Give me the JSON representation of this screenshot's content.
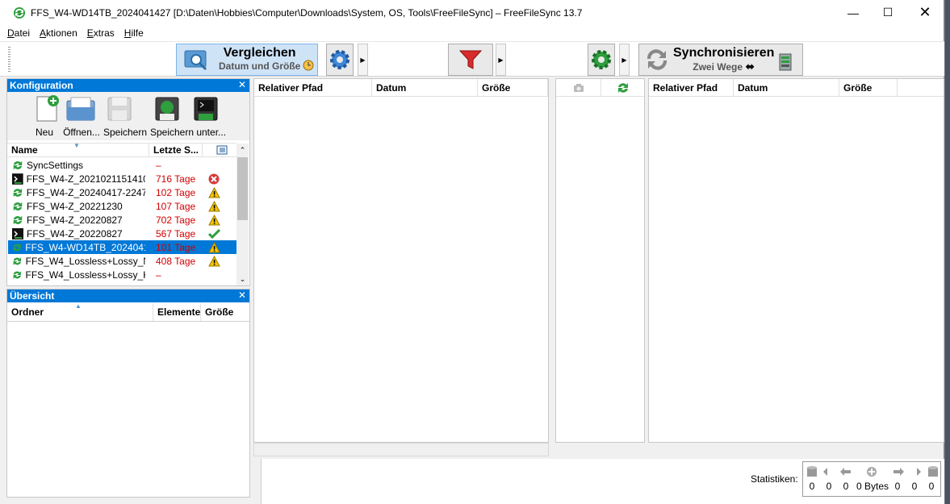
{
  "window": {
    "title": "FFS_W4-WD14TB_2024041427 [D:\\Daten\\Hobbies\\Computer\\Downloads\\System, OS, Tools\\FreeFileSync] – FreeFileSync 13.7"
  },
  "menu": {
    "items": [
      "Datei",
      "Aktionen",
      "Extras",
      "Hilfe"
    ]
  },
  "toolbar": {
    "compare_title": "Vergleichen",
    "compare_sub": "Datum und Größe",
    "sync_title": "Synchronisieren",
    "sync_sub": "Zwei Wege"
  },
  "config_panel": {
    "title": "Konfiguration",
    "buttons": [
      "Neu",
      "Öffnen...",
      "Speichern",
      "Speichern unter..."
    ],
    "columns": {
      "name": "Name",
      "last_sync": "Letzte S..."
    },
    "rows": [
      {
        "name": "SyncSettings",
        "last": "–",
        "status": "",
        "icon": "sync-green-icon"
      },
      {
        "name": "FFS_W4-Z_2021021151410",
        "last": "716 Tage",
        "status": "error-icon",
        "icon": "batch-icon"
      },
      {
        "name": "FFS_W4-Z_20240417-2247",
        "last": "102 Tage",
        "status": "warning-icon",
        "icon": "sync-green-icon"
      },
      {
        "name": "FFS_W4-Z_20221230",
        "last": "107 Tage",
        "status": "warning-icon",
        "icon": "sync-green-icon"
      },
      {
        "name": "FFS_W4-Z_20220827",
        "last": "702 Tage",
        "status": "warning-icon",
        "icon": "sync-green-icon"
      },
      {
        "name": "FFS_W4-Z_20220827",
        "last": "567 Tage",
        "status": "check-icon",
        "icon": "batch-icon"
      },
      {
        "name": "FFS_W4-WD14TB_20240414...",
        "last": "101 Tage",
        "status": "warning-icon",
        "icon": "sync-green-icon",
        "selected": true
      },
      {
        "name": "FFS_W4_Lossless+Lossy_N...",
        "last": "408 Tage",
        "status": "warning-icon",
        "icon": "sync-green-icon"
      },
      {
        "name": "FFS_W4_Lossless+Lossy_Ki...",
        "last": "–",
        "status": "",
        "icon": "sync-green-icon"
      }
    ]
  },
  "overview_panel": {
    "title": "Übersicht",
    "columns": {
      "folder": "Ordner",
      "items": "Elemente",
      "size": "Größe"
    }
  },
  "left_grid": {
    "columns": [
      "Relativer Pfad",
      "Datum",
      "Größe"
    ]
  },
  "right_grid": {
    "columns": [
      "Relativer Pfad",
      "Datum",
      "Größe"
    ]
  },
  "statistics": {
    "label": "Statistiken:",
    "values": [
      "0",
      "0",
      "0",
      "0 Bytes",
      "0",
      "0",
      "0"
    ]
  },
  "colors": {
    "accent": "#0078d7",
    "due": "#d00000"
  }
}
